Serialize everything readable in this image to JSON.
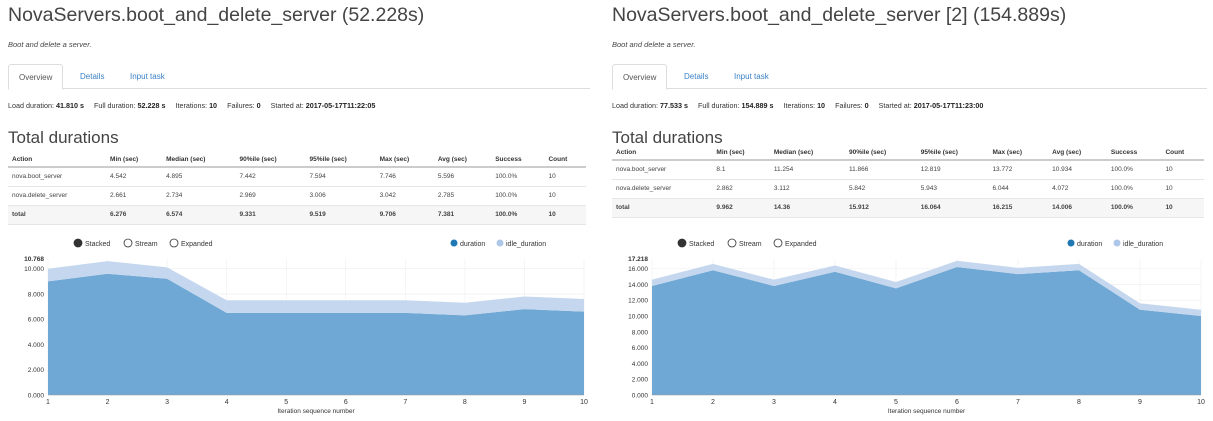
{
  "panels": [
    {
      "title": "NovaServers.boot_and_delete_server (52.228s)",
      "subtitle": "Boot and delete a server.",
      "tabs": [
        {
          "label": "Overview",
          "active": true
        },
        {
          "label": "Details",
          "active": false
        },
        {
          "label": "Input task",
          "active": false
        }
      ],
      "meta": {
        "load_label": "Load duration:",
        "load_value": "41.810 s",
        "full_label": "Full duration:",
        "full_value": "52.228 s",
        "iter_label": "Iterations:",
        "iter_value": "10",
        "fail_label": "Failures:",
        "fail_value": "0",
        "start_label": "Started at:",
        "start_value": "2017-05-17T11:22:05"
      },
      "section_title": "Total durations",
      "table": {
        "headers": [
          "Action",
          "Min (sec)",
          "Median (sec)",
          "90%ile (sec)",
          "95%ile (sec)",
          "Max (sec)",
          "Avg (sec)",
          "Success",
          "Count"
        ],
        "rows": [
          [
            "nova.boot_server",
            "4.542",
            "4.895",
            "7.442",
            "7.594",
            "7.746",
            "5.596",
            "100.0%",
            "10"
          ],
          [
            "nova.delete_server",
            "2.661",
            "2.734",
            "2.969",
            "3.006",
            "3.042",
            "2.785",
            "100.0%",
            "10"
          ],
          [
            "total",
            "6.276",
            "6.574",
            "9.331",
            "9.519",
            "9.706",
            "7.381",
            "100.0%",
            "10"
          ]
        ]
      },
      "chart_controls": {
        "stacked": "Stacked",
        "stream": "Stream",
        "expanded": "Expanded",
        "selected": "stacked"
      },
      "chart_data": {
        "type": "area",
        "x": [
          1,
          2,
          3,
          4,
          5,
          6,
          7,
          8,
          9,
          10
        ],
        "series": [
          {
            "name": "duration",
            "values": [
              9.0,
              9.6,
              9.2,
              6.5,
              6.5,
              6.5,
              6.5,
              6.3,
              6.8,
              6.6
            ]
          },
          {
            "name": "idle_duration",
            "values": [
              1.0,
              1.0,
              0.9,
              1.0,
              1.0,
              1.0,
              1.0,
              1.0,
              1.0,
              1.0
            ]
          }
        ],
        "colors": [
          "#6fa8d4",
          "#c5d7ee"
        ],
        "legend_colors": [
          "#1f77b4",
          "#aec7e8"
        ],
        "yticks": [
          "0.000",
          "2.000",
          "4.000",
          "6.000",
          "8.000",
          "10.000"
        ],
        "ymax_label": "10.768",
        "ylim": [
          0,
          10.768
        ],
        "xlabel": "Iteration sequence number",
        "legend_position": "top-right"
      }
    },
    {
      "title": "NovaServers.boot_and_delete_server [2] (154.889s)",
      "subtitle": "Boot and delete a server.",
      "tabs": [
        {
          "label": "Overview",
          "active": true
        },
        {
          "label": "Details",
          "active": false
        },
        {
          "label": "Input task",
          "active": false
        }
      ],
      "meta": {
        "load_label": "Load duration:",
        "load_value": "77.533 s",
        "full_label": "Full duration:",
        "full_value": "154.889 s",
        "iter_label": "Iterations:",
        "iter_value": "10",
        "fail_label": "Failures:",
        "fail_value": "0",
        "start_label": "Started at:",
        "start_value": "2017-05-17T11:23:00"
      },
      "section_title": "Total durations",
      "table": {
        "headers": [
          "Action",
          "Min (sec)",
          "Median (sec)",
          "90%ile (sec)",
          "95%ile (sec)",
          "Max (sec)",
          "Avg (sec)",
          "Success",
          "Count"
        ],
        "rows": [
          [
            "nova.boot_server",
            "8.1",
            "11.254",
            "11.866",
            "12.819",
            "13.772",
            "10.934",
            "100.0%",
            "10"
          ],
          [
            "nova.delete_server",
            "2.862",
            "3.112",
            "5.842",
            "5.943",
            "6.044",
            "4.072",
            "100.0%",
            "10"
          ],
          [
            "total",
            "9.962",
            "14.36",
            "15.912",
            "16.064",
            "16.215",
            "14.006",
            "100.0%",
            "10"
          ]
        ]
      },
      "chart_controls": {
        "stacked": "Stacked",
        "stream": "Stream",
        "expanded": "Expanded",
        "selected": "stacked"
      },
      "chart_data": {
        "type": "area",
        "x": [
          1,
          2,
          3,
          4,
          5,
          6,
          7,
          8,
          9,
          10
        ],
        "series": [
          {
            "name": "duration",
            "values": [
              13.8,
              15.8,
              13.8,
              15.6,
              13.5,
              16.2,
              15.3,
              15.8,
              10.8,
              10.0
            ]
          },
          {
            "name": "idle_duration",
            "values": [
              0.8,
              0.8,
              0.8,
              0.8,
              0.8,
              0.8,
              0.8,
              0.8,
              0.8,
              0.8
            ]
          }
        ],
        "colors": [
          "#6fa8d4",
          "#c5d7ee"
        ],
        "legend_colors": [
          "#1f77b4",
          "#aec7e8"
        ],
        "yticks": [
          "0.000",
          "2.000",
          "4.000",
          "6.000",
          "8.000",
          "10.000",
          "12.000",
          "14.000",
          "16.000"
        ],
        "ymax_label": "17.218",
        "ylim": [
          0,
          17.218
        ],
        "xlabel": "Iteration sequence number",
        "legend_position": "top-right"
      }
    }
  ]
}
